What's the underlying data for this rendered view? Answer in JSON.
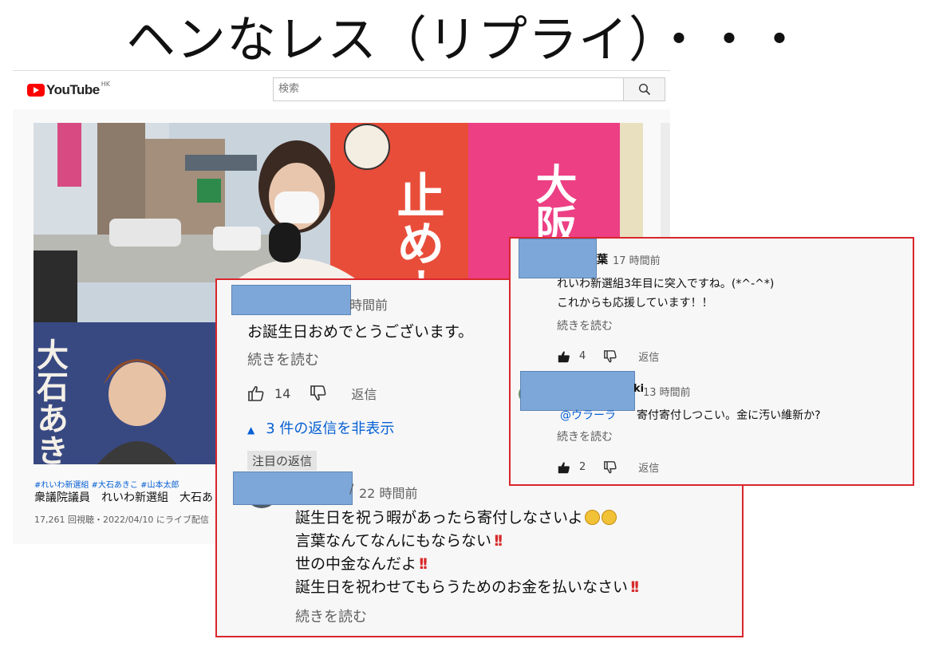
{
  "slide": {
    "title": "ヘンなレス（リプライ）・・・"
  },
  "youtube": {
    "logo_text": "YouTube",
    "region": "HK",
    "search_placeholder": "検索",
    "search_icon": "search-icon",
    "video": {
      "tags": "#れいわ新選組 #大石あきこ #山本太郎",
      "title": "衆議院議員　れいわ新選組　大石あ",
      "meta": "17,261 回視聴・2022/04/10 にライブ配信",
      "poster_text": "大石あき",
      "banner_text_1": "止めよ",
      "banner_text_2": "大阪いらん"
    }
  },
  "comment_panel_1": {
    "main_comment": {
      "time": "時間前",
      "text": "お誕生日おめでとうございます。",
      "read_more": "続きを読む",
      "likes": "14",
      "reply_label": "返信",
      "hide_replies": "3 件の返信を非表示"
    },
    "featured_label": "注目の返信",
    "reply": {
      "time": "22 時間前",
      "lines": [
        "誕生日を祝う暇があったら寄付しなさいよ",
        "言葉なんてなんにもならない",
        "世の中金なんだよ",
        "誕生日を祝わせてもらうためのお金を払いなさい"
      ],
      "read_more": "続きを読む"
    }
  },
  "comment_panel_2": {
    "comment_a": {
      "name_suffix": "葉",
      "time": "17 時間前",
      "lines": [
        "れいわ新選組3年目に突入ですね。(*^-^*)",
        "これからも応援しています！！"
      ],
      "read_more": "続きを読む",
      "likes": "4",
      "reply_label": "返信"
    },
    "comment_b": {
      "name_suffix": "ki",
      "time": "13 時間前",
      "mention": "@ウラーラ",
      "text": "寄付寄付しつこい。金に汚い維新か?",
      "read_more": "続きを読む",
      "likes": "2",
      "reply_label": "返信"
    }
  },
  "colors": {
    "highlight_border": "#d9262c",
    "redaction_blue": "#7da7d9",
    "link_blue": "#065fd4",
    "youtube_red": "#ff0000"
  }
}
